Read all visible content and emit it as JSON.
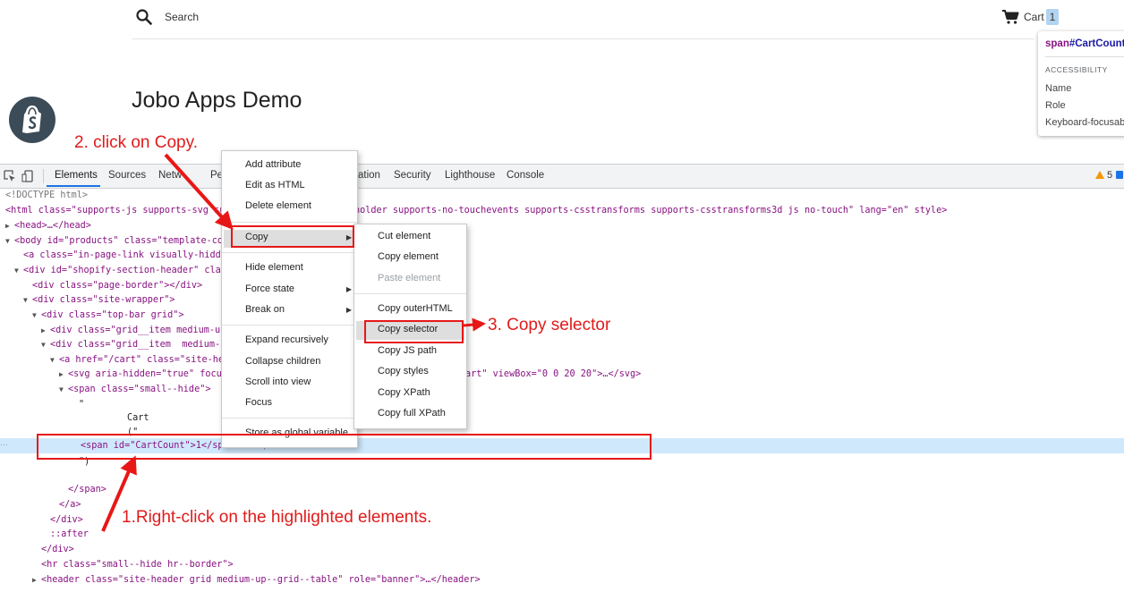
{
  "store": {
    "search_label": "Search",
    "cart_label": "Cart",
    "cart_count": "1",
    "title": "Jobo Apps Demo"
  },
  "inspector_tooltip": {
    "selector_tag": "span",
    "selector_id": "#CartCount",
    "section": "ACCESSIBILITY",
    "rows": [
      "Name",
      "Role",
      "Keyboard-focusab"
    ]
  },
  "devtools": {
    "tabs": [
      "Elements",
      "Sources",
      "Netw",
      "Pe",
      "ation",
      "Security",
      "Lighthouse",
      "Console"
    ],
    "warning_count": "5",
    "code": {
      "doctype": "<!DOCTYPE html>",
      "html_open_a": "<html class=\"supports-js supports-svg sup",
      "html_open_b": "holder supports-no-touchevents supports-csstransforms supports-csstransforms3d js no-touch\" lang=\"en\" style>",
      "head": "<head>…</head>",
      "body": "<body id=\"products\" class=\"template-colle",
      "a_skip": "<a class=\"in-page-link visually-hidden s",
      "div_section": "<div id=\"shopify-section-header\" class=\"",
      "div_page_border": "<div class=\"page-border\"></div>",
      "div_site_wrapper": "<div class=\"site-wrapper\">",
      "div_top_bar": "<div class=\"top-bar grid\">",
      "div_grid_item_1": "<div class=\"grid__item medium-up--",
      "div_grid_item_2": "<div class=\"grid__item  medium-up-",
      "a_cart": "<a href=\"/cart\" class=\"site-heade",
      "svg": "<svg aria-hidden=\"true\" focusab",
      "svg_tail": "art\" viewBox=\"0 0 20 20\">…</svg>",
      "span_small_hide": "<span class=\"small--hide\">",
      "quote_open": "\"",
      "text_cart": "Cart",
      "text_paren": "(\"",
      "span_cartcount": "<span id=\"CartCount\">1</span> == $0",
      "quote_close": "\")",
      "span_close": "</span>",
      "a_close": "</a>",
      "div_close_1": "</div>",
      "after": "::after",
      "div_close_2": "</div>",
      "hr": "<hr class=\"small--hide hr--border\">",
      "header": "<header class=\"site-header grid medium-up--grid--table\" role=\"banner\">…</header>",
      "tail_obscured": ">"
    }
  },
  "context_menu": {
    "items": [
      "Add attribute",
      "Edit as HTML",
      "Delete element",
      "Copy",
      "Hide element",
      "Force state",
      "Break on",
      "Expand recursively",
      "Collapse children",
      "Scroll into view",
      "Focus",
      "Store as global variable"
    ]
  },
  "copy_submenu": {
    "items": [
      "Cut element",
      "Copy element",
      "Paste element",
      "Copy outerHTML",
      "Copy selector",
      "Copy JS path",
      "Copy styles",
      "Copy XPath",
      "Copy full XPath"
    ]
  },
  "annotations": {
    "step1": "1.Right-click on the highlighted elements.",
    "step2": "2. click on Copy.",
    "step3": "3. Copy selector",
    "color": "#e01b1b"
  }
}
